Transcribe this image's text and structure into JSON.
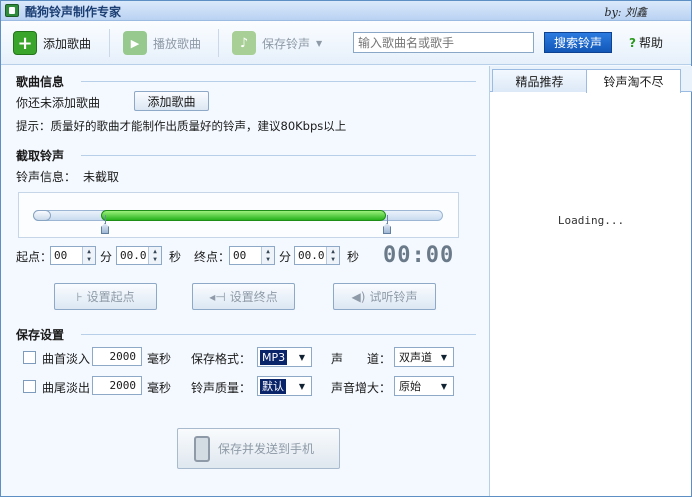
{
  "window": {
    "title": "酷狗铃声制作专家",
    "author": "by: 刘鑫"
  },
  "toolbar": {
    "add_song": "添加歌曲",
    "play_song": "播放歌曲",
    "save_ringtone": "保存铃声",
    "search_placeholder": "输入歌曲名或歌手",
    "search_button": "搜索铃声",
    "help": "帮助"
  },
  "song_info": {
    "heading": "歌曲信息",
    "status": "你还未添加歌曲",
    "add_button": "添加歌曲",
    "tip": "提示：质量好的歌曲才能制作出质量好的铃声，建议80Kbps以上"
  },
  "cut": {
    "heading": "截取铃声",
    "info_label": "铃声信息：",
    "info_value": "未截取",
    "start_label": "起点：",
    "start_min": "00",
    "start_sec": "00.0",
    "end_label": "终点：",
    "end_min": "00",
    "end_sec": "00.0",
    "min_unit": "分",
    "sec_unit": "秒",
    "time_display": "00:00",
    "set_start": "设置起点",
    "set_end": "设置终点",
    "preview": "试听铃声"
  },
  "save": {
    "heading": "保存设置",
    "fade_in_label": "曲首淡入",
    "fade_in_value": "2000",
    "fade_out_label": "曲尾淡出",
    "fade_out_value": "2000",
    "ms_unit": "毫秒",
    "format_label": "保存格式：",
    "format_value": "MP3",
    "quality_label": "铃声质量：",
    "quality_value": "默认",
    "channel_label": "声　　道：",
    "channel_value": "双声道",
    "volume_label": "声音增大：",
    "volume_value": "原始",
    "send_button": "保存并发送到手机"
  },
  "right_panel": {
    "tabs": [
      "精品推荐",
      "铃声淘不尽"
    ],
    "loading": "Loading..."
  }
}
